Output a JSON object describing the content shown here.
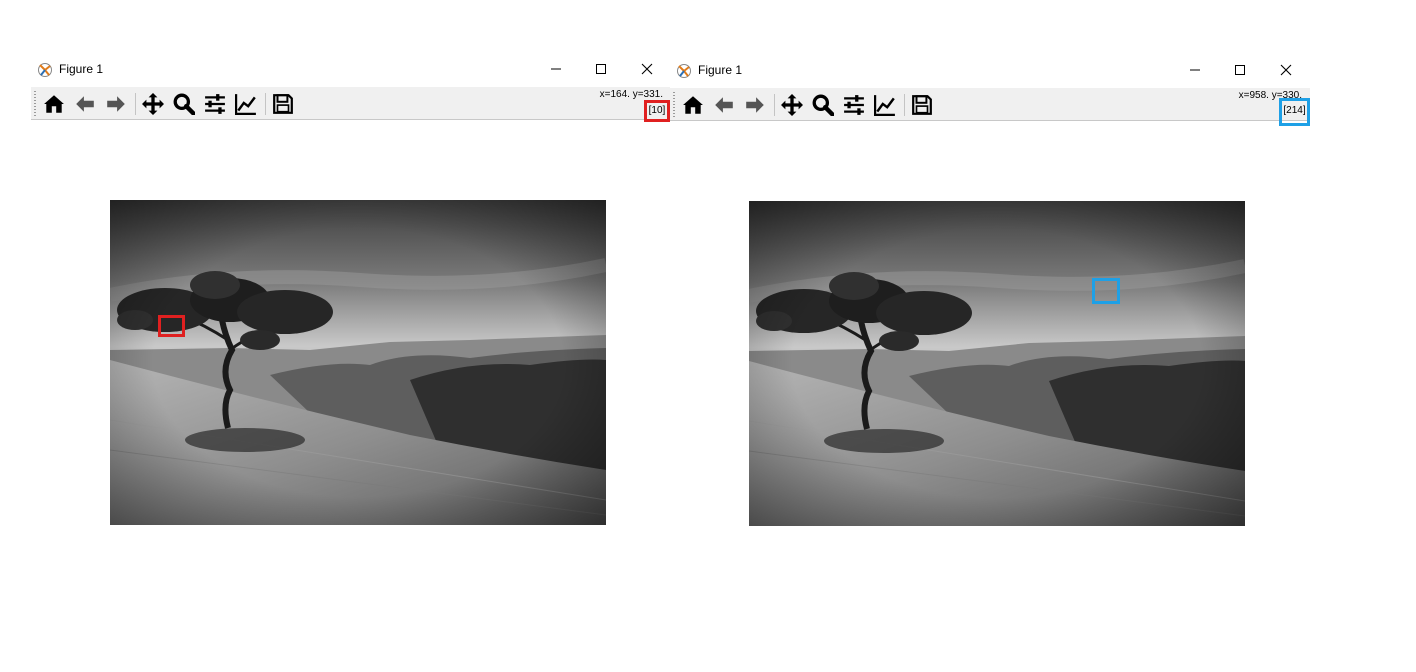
{
  "windows": [
    {
      "title": "Figure 1",
      "coord_readout": "x=164. y=331.",
      "pixel_value": "[10]",
      "highlight_color": "#e02020"
    },
    {
      "title": "Figure 1",
      "coord_readout": "x=958. y=330.",
      "pixel_value": "[214]",
      "highlight_color": "#1ea0e6"
    }
  ],
  "toolbar_icons": [
    "home-icon",
    "back-arrow-icon",
    "forward-arrow-icon",
    "pan-icon",
    "zoom-icon",
    "configure-subplots-icon",
    "edit-axis-icon",
    "save-icon"
  ],
  "titlebar_icons": [
    "minimize-icon",
    "maximize-icon",
    "close-icon"
  ]
}
